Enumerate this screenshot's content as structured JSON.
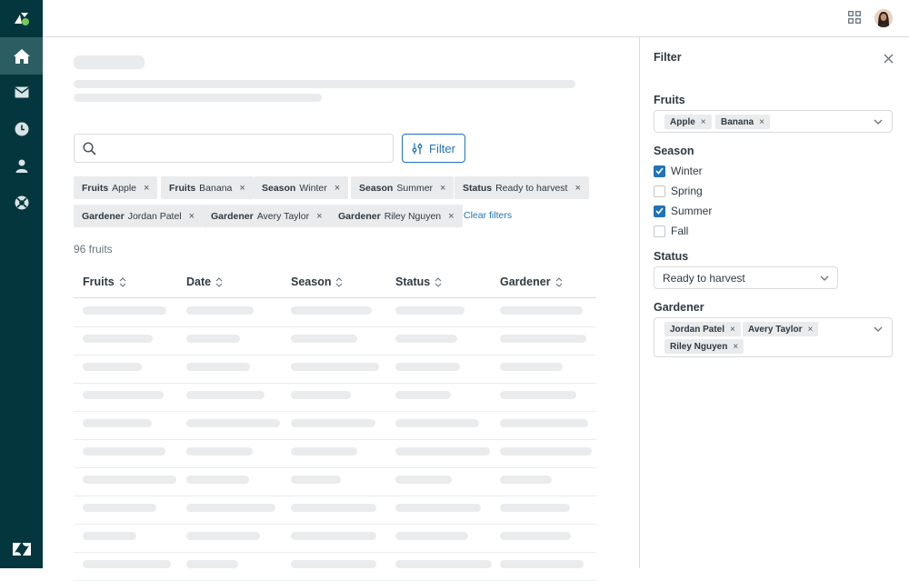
{
  "colors": {
    "nav_bg": "#03363d",
    "nav_active": "#2b5d63",
    "accent": "#1f73b7",
    "skeleton": "#e9ebed"
  },
  "nav": {
    "logo_icon": "zendesk-logo-icon",
    "items": [
      {
        "icon": "home-icon",
        "active": true
      },
      {
        "icon": "mail-icon",
        "active": false
      },
      {
        "icon": "clock-icon",
        "active": false
      },
      {
        "icon": "user-icon",
        "active": false
      },
      {
        "icon": "support-icon",
        "active": false
      }
    ],
    "bottom_icon": "zendesk-wordmark-icon"
  },
  "header": {
    "apps_icon": "grid-icon",
    "avatar_icon": "avatar"
  },
  "search": {
    "placeholder": "",
    "icon": "search-icon"
  },
  "filter_button": {
    "label": "Filter",
    "icon": "sliders-icon"
  },
  "chips": [
    {
      "key": "Fruits",
      "value": "Apple"
    },
    {
      "key": "Fruits",
      "value": "Banana"
    },
    {
      "key": "Season",
      "value": "Winter"
    },
    {
      "key": "Season",
      "value": "Summer"
    },
    {
      "key": "Status",
      "value": "Ready to harvest"
    },
    {
      "key": "Gardener",
      "value": "Jordan Patel"
    },
    {
      "key": "Gardener",
      "value": "Avery Taylor"
    },
    {
      "key": "Gardener",
      "value": "Riley Nguyen"
    }
  ],
  "chip_remove_glyph": "×",
  "clear_filters": "Clear filters",
  "results_count": "96 fruits",
  "table": {
    "columns": [
      "Fruits",
      "Date",
      "Season",
      "Status",
      "Gardener"
    ]
  },
  "panel": {
    "title": "Filter",
    "close_icon": "close-icon",
    "fruits": {
      "label": "Fruits",
      "tags": [
        "Apple",
        "Banana"
      ]
    },
    "season": {
      "label": "Season",
      "options": [
        {
          "label": "Winter",
          "checked": true
        },
        {
          "label": "Spring",
          "checked": false
        },
        {
          "label": "Summer",
          "checked": true
        },
        {
          "label": "Fall",
          "checked": false
        }
      ]
    },
    "status": {
      "label": "Status",
      "selected": "Ready to harvest"
    },
    "gardener": {
      "label": "Gardener",
      "tags": [
        "Jordan Patel",
        "Avery Taylor",
        "Riley Nguyen"
      ]
    }
  }
}
